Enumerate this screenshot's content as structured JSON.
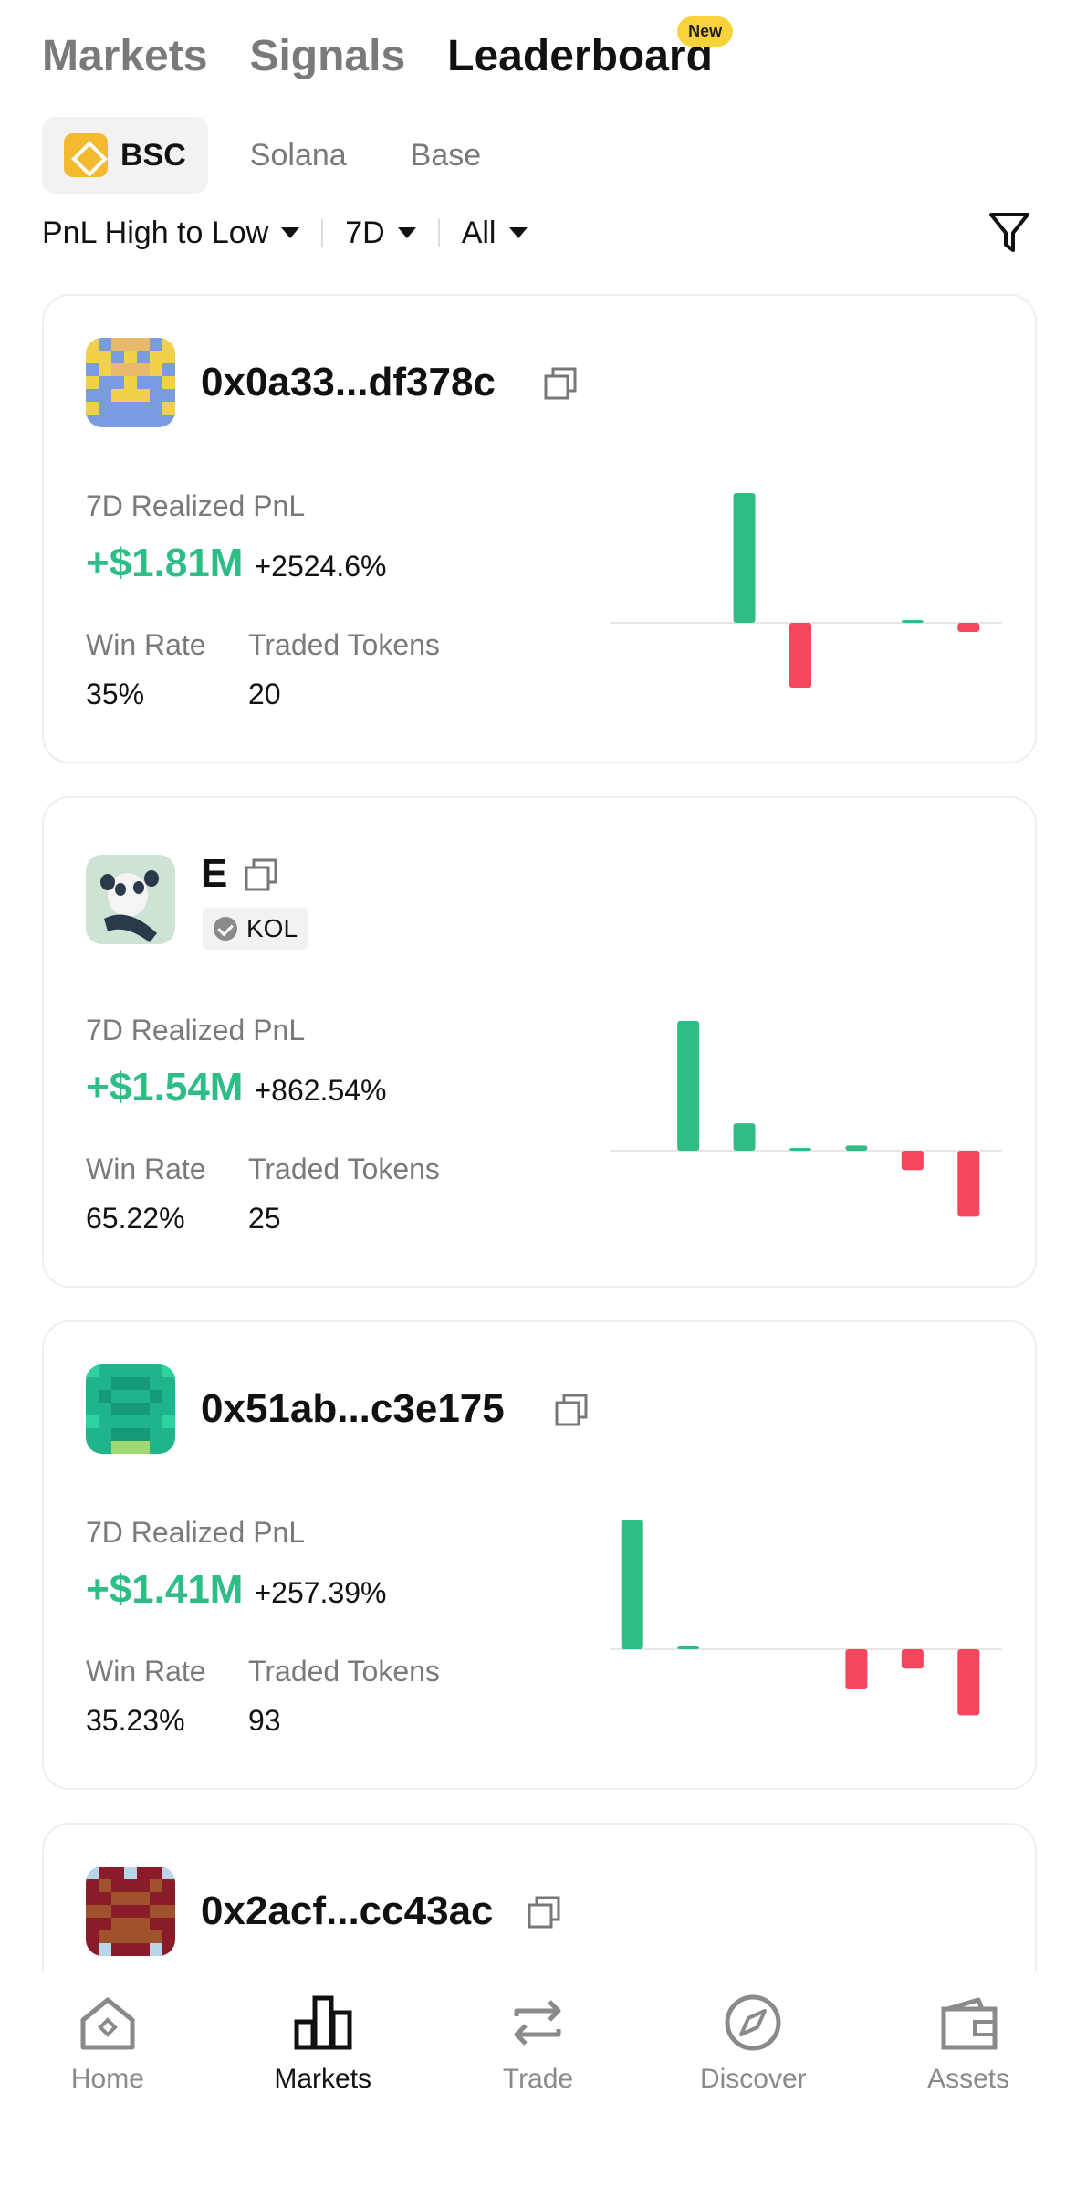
{
  "top_tabs": [
    {
      "label": "Markets",
      "active": false
    },
    {
      "label": "Signals",
      "active": false
    },
    {
      "label": "Leaderboard",
      "active": true
    }
  ],
  "new_badge": "New",
  "chains": [
    {
      "label": "BSC",
      "active": true
    },
    {
      "label": "Solana",
      "active": false
    },
    {
      "label": "Base",
      "active": false
    }
  ],
  "filters": {
    "sort": "PnL High to Low",
    "period": "7D",
    "type": "All"
  },
  "cards": [
    {
      "address": "0x0a33...df378c",
      "pnl_label": "7D Realized PnL",
      "pnl": "+$1.81M",
      "pnl_pct": "+2524.6%",
      "win_rate_label": "Win Rate",
      "win_rate": "35%",
      "tokens_label": "Traded Tokens",
      "tokens": "20",
      "bars": [
        0,
        0,
        1.0,
        -0.5,
        0,
        0.02,
        -0.07
      ]
    },
    {
      "address": "E",
      "badge": "KOL",
      "pnl_label": "7D Realized PnL",
      "pnl": "+$1.54M",
      "pnl_pct": "+862.54%",
      "win_rate_label": "Win Rate",
      "win_rate": "65.22%",
      "tokens_label": "Traded Tokens",
      "tokens": "25",
      "bars": [
        0,
        1.0,
        0.21,
        0.02,
        0.04,
        -0.15,
        -0.51
      ]
    },
    {
      "address": "0x51ab...c3e175",
      "pnl_label": "7D Realized PnL",
      "pnl": "+$1.41M",
      "pnl_pct": "+257.39%",
      "win_rate_label": "Win Rate",
      "win_rate": "35.23%",
      "tokens_label": "Traded Tokens",
      "tokens": "93",
      "bars": [
        1.0,
        0.02,
        0,
        0,
        -0.31,
        -0.15,
        -0.51
      ]
    },
    {
      "address": "0x2acf...cc43ac"
    }
  ],
  "bottom_nav": [
    {
      "label": "Home",
      "icon": "home-icon",
      "active": false
    },
    {
      "label": "Markets",
      "icon": "bar-chart-icon",
      "active": true
    },
    {
      "label": "Trade",
      "icon": "swap-icon",
      "active": false
    },
    {
      "label": "Discover",
      "icon": "compass-icon",
      "active": false
    },
    {
      "label": "Assets",
      "icon": "wallet-icon",
      "active": false
    }
  ],
  "colors": {
    "positive": "#2ebd85",
    "negative": "#f6465d",
    "badge": "#f7d23a",
    "bsc": "#f3ba2f"
  }
}
